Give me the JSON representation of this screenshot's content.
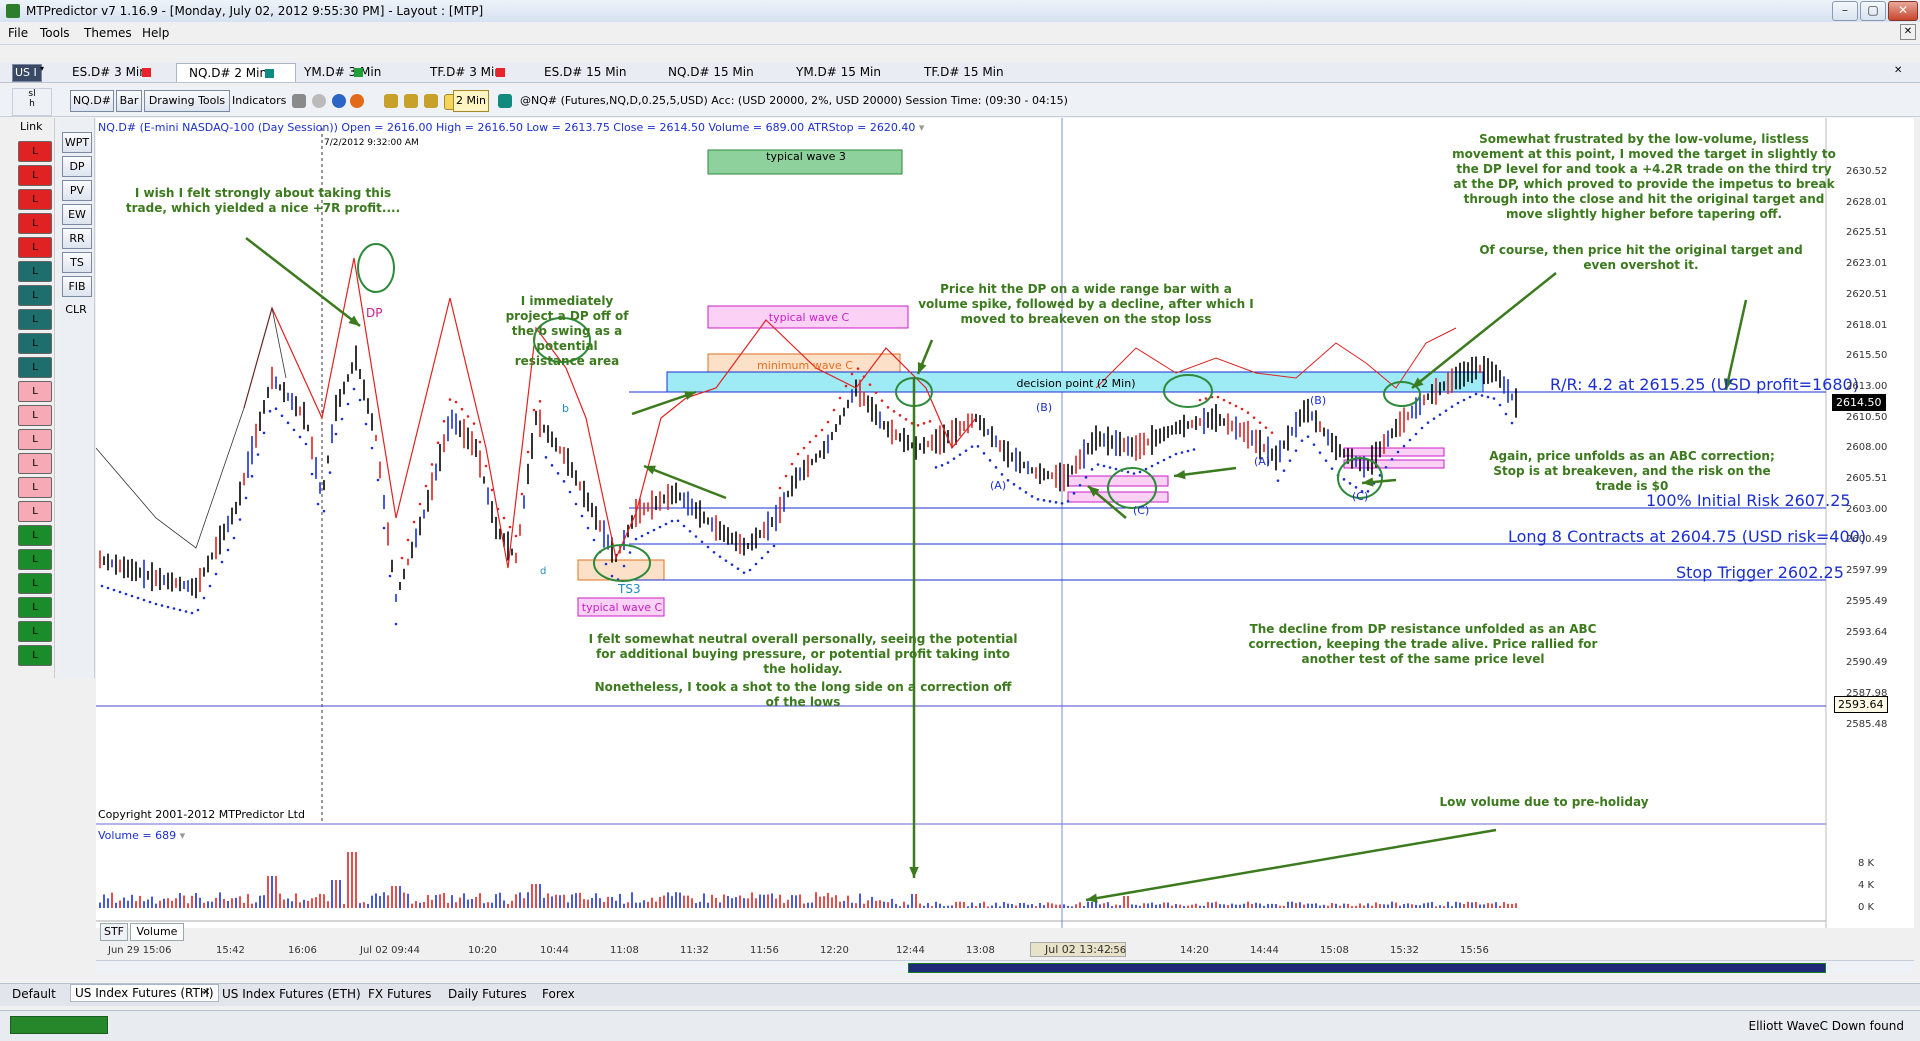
{
  "window": {
    "title": "MTPredictor v7 1.16.9 - [Monday, July 02, 2012 9:55:30 PM] - Layout : [MTP]"
  },
  "menu": [
    "File",
    "Tools",
    "Themes",
    "Help"
  ],
  "chart_tabs": [
    {
      "label": "ES.D# 3 Min",
      "color": "#e8232b"
    },
    {
      "label": "NQ.D# 2 Min",
      "color": "#0e8a82"
    },
    {
      "label": "YM.D# 3 Min",
      "color": "#21a03a"
    },
    {
      "label": "TF.D# 3 Min",
      "color": "#e8232b"
    },
    {
      "label": "ES.D# 15 Min",
      "color": ""
    },
    {
      "label": "NQ.D# 15 Min",
      "color": ""
    },
    {
      "label": "YM.D# 15 Min",
      "color": ""
    },
    {
      "label": "TF.D# 15 Min",
      "color": ""
    }
  ],
  "toolbar": {
    "symbol_button": "NQ.D#",
    "bar_button": "Bar",
    "drawing_tools_button": "Drawing Tools",
    "indicators_label": "Indicators",
    "interval_button": "2 Min",
    "session_info": "@NQ# (Futures,NQ,D,0.25,5,USD) Acc: (USD 20000, 2%, USD 20000) Session Time: (09:30 - 04:15)"
  },
  "left_panel": {
    "us_label": "US I",
    "link_label": "Link",
    "link_buttons": [
      "L",
      "L",
      "L",
      "L",
      "L",
      "L",
      "L",
      "L",
      "L",
      "L",
      "L",
      "L",
      "L",
      "L",
      "L",
      "L",
      "L",
      "L",
      "L",
      "L",
      "L",
      "L"
    ],
    "tool_buttons": [
      "WPT",
      "DP",
      "PV",
      "EW",
      "RR",
      "TS",
      "FIB",
      "CLR"
    ]
  },
  "chart": {
    "header": "NQ.D# (E-mini NASDAQ-100 (Day Session)) Open = 2616.00  High = 2616.50  Low = 2613.75  Close = 2614.50  Volume = 689.00  ATRStop = 2620.40",
    "cursor_time": "7/2/2012 9:32:00 AM",
    "copyright": "Copyright 2001-2012 MTPredictor Ltd",
    "volume_label": "Volume = 689",
    "price_labels": [
      "2630.52",
      "2628.01",
      "2625.51",
      "2623.01",
      "2620.51",
      "2618.01",
      "2615.50",
      "2613.00",
      "2610.50",
      "2608.00",
      "2605.51",
      "2603.00",
      "2600.49",
      "2597.99",
      "2595.49",
      "2593.64",
      "2590.49",
      "2587.98",
      "2585.48"
    ],
    "current_price": "2614.50",
    "level_price": "2593.64",
    "volume_ticks": [
      "8 K",
      "4 K",
      "0 K"
    ],
    "time_labels": [
      "Jun 29 15:06",
      "15:42",
      "16:06",
      "Jul 02 09:44",
      "10:20",
      "10:44",
      "11:08",
      "11:32",
      "11:56",
      "12:20",
      "12:44",
      "13:08",
      "Jul 02 13:42",
      ":56",
      "14:20",
      "14:44",
      "15:08",
      "15:32",
      "15:56"
    ],
    "bottom_tabs": [
      "STF",
      "Volume"
    ],
    "zones": {
      "typical_wave_3": "typical wave 3",
      "typical_wave_c_top": "typical wave C",
      "minimum_wave_c": "minimum wave C",
      "decision_point": "decision point (2 Min)",
      "typical_wave_c_bottom": "typical wave C"
    },
    "markers": {
      "dp": "DP",
      "b_small": "b",
      "d_small": "d",
      "ts3": "TS3",
      "a1": "(A)",
      "b1": "(B)",
      "c1": "(C)",
      "a2": "(A)",
      "b2": "(B)",
      "c2": "(C)"
    },
    "trade_lines": {
      "rr": "R/R: 4.2 at 2615.25 (USD profit=1680)",
      "initial_risk": "100% Initial Risk 2607.25",
      "long_entry": "Long 8 Contracts at 2604.75 (USD risk=400)",
      "stop_trigger": "Stop Trigger 2602.25"
    },
    "annotations": {
      "a1": "I wish I felt strongly about taking this trade, which yielded a nice +7R profit....",
      "a2": "I immediately project a DP off of the b swing as a potential resistance area",
      "a3": "Price hit the DP on a wide range bar with a volume spike, followed by a decline, after which I moved to breakeven on the stop loss",
      "a4": "Somewhat frustrated by the low-volume, listless movement at this point, I moved the target in slightly to the DP level for and took a +4.2R trade on the third try at the DP, which proved to provide the impetus to break through into the close and hit the original target and move slightly higher before tapering off.",
      "a5": "Of course, then price hit the original target and even overshot it.",
      "a6": "Again, price unfolds as an ABC correction; Stop is at breakeven, and the risk on the trade is $0",
      "a7": "I felt somewhat neutral overall personally, seeing the potential for additional buying pressure, or potential profit taking into the holiday.",
      "a8": "Nonetheless, I took a shot to the long side on a correction off of the lows",
      "a9": "The decline from DP resistance unfolded as an ABC correction, keeping the trade alive. Price rallied for another test of the same price level",
      "a10": "Low volume due to pre-holiday"
    }
  },
  "layout_tabs": [
    "Default",
    "US Index Futures (RTH)",
    "US Index Futures (ETH)",
    "FX Futures",
    "Daily Futures",
    "Forex"
  ],
  "status": "Elliott WaveC Down found"
}
